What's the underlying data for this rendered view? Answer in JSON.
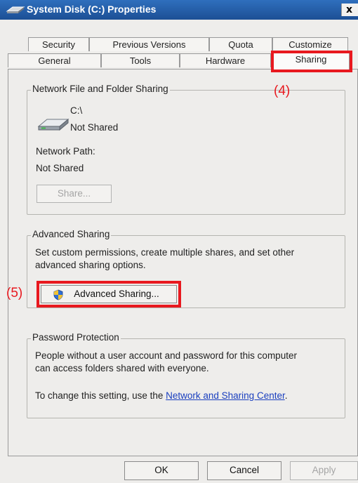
{
  "window": {
    "title": "System Disk (C:) Properties",
    "close_glyph": "x"
  },
  "tabs": {
    "row1": [
      "Security",
      "Previous Versions",
      "Quota",
      "Customize"
    ],
    "row2": [
      "General",
      "Tools",
      "Hardware",
      "Sharing"
    ],
    "selected": "Sharing"
  },
  "network_sharing": {
    "legend": "Network File and Folder Sharing",
    "drive_name": "C:\\",
    "drive_status": "Not Shared",
    "path_label": "Network Path:",
    "path_value": "Not Shared",
    "share_button": "Share..."
  },
  "advanced_sharing": {
    "legend": "Advanced Sharing",
    "description_line1": "Set custom permissions, create multiple shares, and set other",
    "description_line2": "advanced sharing options.",
    "button": "Advanced Sharing..."
  },
  "password_protection": {
    "legend": "Password Protection",
    "line1": "People without a user account and password for this computer",
    "line2": "can access folders shared with everyone.",
    "change_prefix": "To change this setting, use the ",
    "link": "Network and Sharing Center",
    "change_suffix": "."
  },
  "footer": {
    "ok": "OK",
    "cancel": "Cancel",
    "apply": "Apply"
  },
  "annotations": {
    "step4": "(4)",
    "step5": "(5)",
    "highlight_color": "#e8191f"
  }
}
